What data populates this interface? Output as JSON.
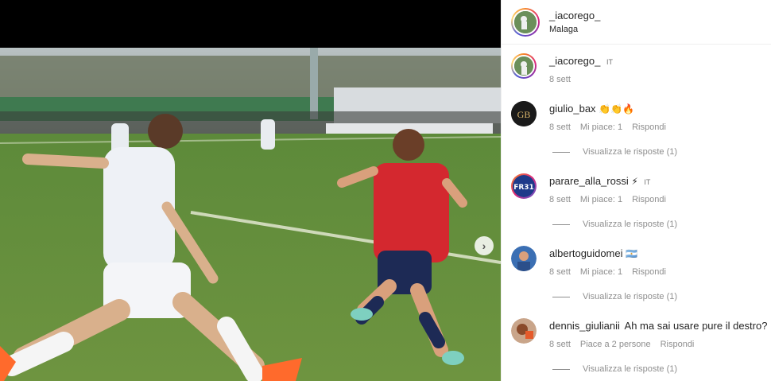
{
  "post": {
    "username": "_iacorego_",
    "location": "Malaga"
  },
  "media": {
    "next_icon": "chevron-right-icon"
  },
  "comments": [
    {
      "username": "_iacorego_",
      "text": "",
      "emoji": "",
      "flag": "IT",
      "time": "8 sett",
      "likes": "",
      "reply": "",
      "view_replies": ""
    },
    {
      "username": "giulio_bax",
      "text": "",
      "emoji": "👏👏🔥",
      "flag": "",
      "time": "8 sett",
      "likes": "Mi piace: 1",
      "reply": "Rispondi",
      "view_replies": "Visualizza le risposte (1)"
    },
    {
      "username": "parare_alla_rossi",
      "text": "",
      "emoji": "⚡",
      "flag": "IT",
      "time": "8 sett",
      "likes": "Mi piace: 1",
      "reply": "Rispondi",
      "view_replies": "Visualizza le risposte (1)"
    },
    {
      "username": "albertoguidomei",
      "text": "",
      "emoji": "🇦🇷",
      "flag": "",
      "time": "8 sett",
      "likes": "Mi piace: 1",
      "reply": "Rispondi",
      "view_replies": "Visualizza le risposte (1)"
    },
    {
      "username": "dennis_giulianii",
      "text": "Ah ma sai usare pure il destro?",
      "emoji": "",
      "flag": "",
      "time": "8 sett",
      "likes": "Piace a 2 persone",
      "reply": "Rispondi",
      "view_replies": "Visualizza le risposte (1)"
    }
  ],
  "colors": {
    "text": "#262626",
    "muted": "#8e8e8e",
    "border": "#efefef"
  }
}
